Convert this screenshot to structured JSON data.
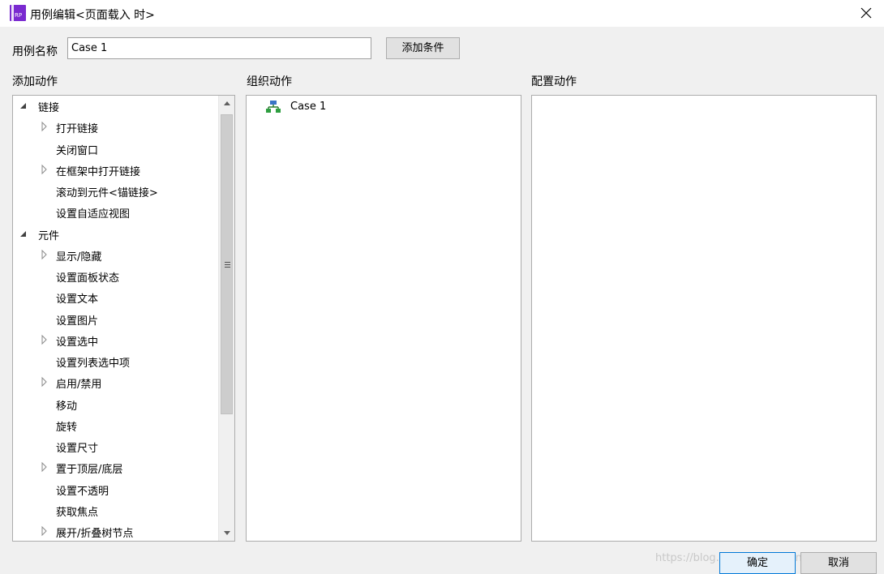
{
  "window": {
    "app_icon_text": "RP",
    "title": "用例编辑<页面载入 时>",
    "accent_color": "#7a2ad0"
  },
  "form": {
    "case_name_label": "用例名称",
    "case_name_value": "Case 1",
    "add_condition_label": "添加条件"
  },
  "sections": {
    "add_actions": "添加动作",
    "organize_actions": "组织动作",
    "configure_actions": "配置动作"
  },
  "action_tree": [
    {
      "label": "链接",
      "level": 0,
      "state": "expanded"
    },
    {
      "label": "打开链接",
      "level": 1,
      "state": "collapsed"
    },
    {
      "label": "关闭窗口",
      "level": 1,
      "state": "leaf"
    },
    {
      "label": "在框架中打开链接",
      "level": 1,
      "state": "collapsed"
    },
    {
      "label": "滚动到元件<锚链接>",
      "level": 1,
      "state": "leaf"
    },
    {
      "label": "设置自适应视图",
      "level": 1,
      "state": "leaf"
    },
    {
      "label": "元件",
      "level": 0,
      "state": "expanded"
    },
    {
      "label": "显示/隐藏",
      "level": 1,
      "state": "collapsed"
    },
    {
      "label": "设置面板状态",
      "level": 1,
      "state": "leaf"
    },
    {
      "label": "设置文本",
      "level": 1,
      "state": "leaf"
    },
    {
      "label": "设置图片",
      "level": 1,
      "state": "leaf"
    },
    {
      "label": "设置选中",
      "level": 1,
      "state": "collapsed"
    },
    {
      "label": "设置列表选中项",
      "level": 1,
      "state": "leaf"
    },
    {
      "label": "启用/禁用",
      "level": 1,
      "state": "collapsed"
    },
    {
      "label": "移动",
      "level": 1,
      "state": "leaf"
    },
    {
      "label": "旋转",
      "level": 1,
      "state": "leaf"
    },
    {
      "label": "设置尺寸",
      "level": 1,
      "state": "leaf"
    },
    {
      "label": "置于顶层/底层",
      "level": 1,
      "state": "collapsed"
    },
    {
      "label": "设置不透明",
      "level": 1,
      "state": "leaf"
    },
    {
      "label": "获取焦点",
      "level": 1,
      "state": "leaf"
    },
    {
      "label": "展开/折叠树节点",
      "level": 1,
      "state": "collapsed"
    }
  ],
  "organize": {
    "case_label": "Case 1"
  },
  "footer": {
    "ok_label": "确定",
    "cancel_label": "取消",
    "watermark": "https://blog.csdn.net/weixin_51802869"
  }
}
